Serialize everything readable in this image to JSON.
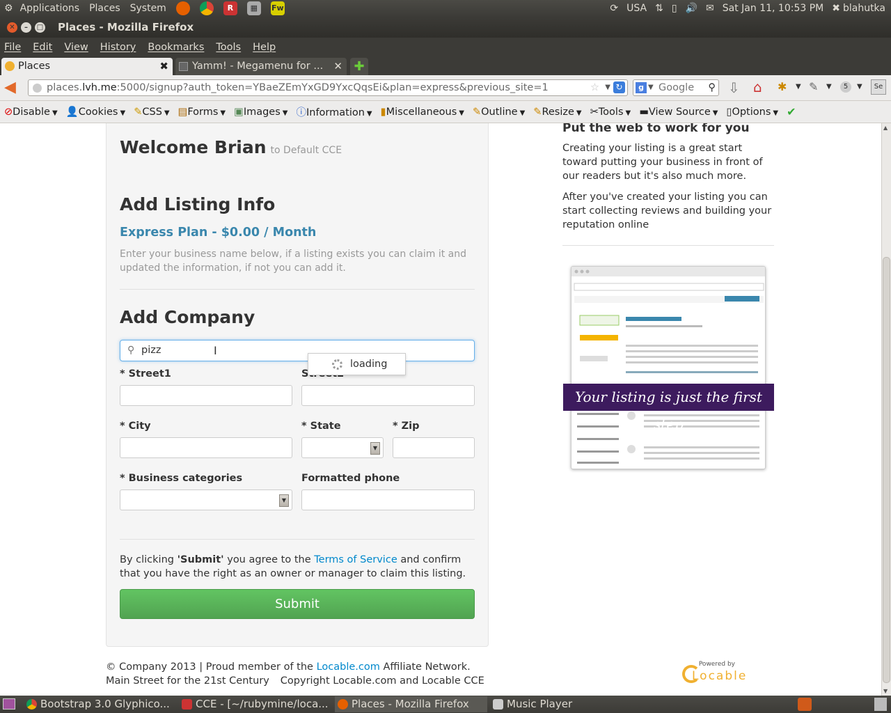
{
  "panel": {
    "menus": [
      "Applications",
      "Places",
      "System"
    ],
    "keyboard": "USA",
    "clock": "Sat Jan 11, 10:53 PM",
    "user": "blahutka"
  },
  "window": {
    "title": "Places - Mozilla Firefox"
  },
  "menubar": [
    "File",
    "Edit",
    "View",
    "History",
    "Bookmarks",
    "Tools",
    "Help"
  ],
  "tabs": [
    {
      "label": "Places"
    },
    {
      "label": "Yamm! - Megamenu for ..."
    }
  ],
  "navbar": {
    "url_prefix": "places.",
    "url_domain": "lvh.me",
    "url_rest": ":5000/signup?auth_token=YBaeZEmYxGD9YxcQqsEi&plan=express&previous_site=1",
    "search_placeholder": "Google",
    "badge_count": "5"
  },
  "devbar": [
    "Disable",
    "Cookies",
    "CSS",
    "Forms",
    "Images",
    "Information",
    "Miscellaneous",
    "Outline",
    "Resize",
    "Tools",
    "View Source",
    "Options"
  ],
  "page": {
    "welcome": "Welcome Brian",
    "welcome_sub": "to Default CCE",
    "add_listing_title": "Add Listing Info",
    "plan": "Express Plan - $0.00 / Month",
    "help_text": "Enter your business name below, if a listing exists you can claim it and updated the information, if not you can add it.",
    "add_company_title": "Add Company",
    "search_value": "pizz",
    "loading": "loading",
    "labels": {
      "street1": "* Street1",
      "street2": "Street2",
      "city": "* City",
      "state": "* State",
      "zip": "* Zip",
      "categories": "* Business categories",
      "phone": "Formatted phone"
    },
    "terms_before": "By clicking ",
    "terms_submit": "'Submit'",
    "terms_middle": " you agree to the ",
    "terms_link": "Terms of Service",
    "terms_after": " and confirm that you have the right as an owner or manager to claim this listing.",
    "submit": "Submit"
  },
  "sidebar": {
    "title": "Put the web to work for you",
    "p1": "Creating your listing is a great start toward putting your business in front of our readers but it's also much more.",
    "p2": "After you've created your listing you can start collecting reviews and building your reputation online",
    "banner": "Your listing is just the first step"
  },
  "footer": {
    "line1_before": "© Company 2013 | Proud member of the ",
    "line1_link": "Locable.com",
    "line1_after": " Affiliate Network.",
    "line2a": "Main Street for the 21st Century",
    "line2b": "Copyright Locable.com and Locable CCE",
    "powered_by": "Powered by",
    "logo": "Locable"
  },
  "taskbar": [
    {
      "label": "Bootstrap 3.0 Glyphico..."
    },
    {
      "label": "CCE - [~/rubymine/loca..."
    },
    {
      "label": "Places - Mozilla Firefox"
    },
    {
      "label": "Music Player"
    }
  ],
  "colors": {
    "link": "#0088cc",
    "plan": "#3a87ad",
    "submit": "#5bb75b",
    "banner": "#3d1b5e"
  }
}
